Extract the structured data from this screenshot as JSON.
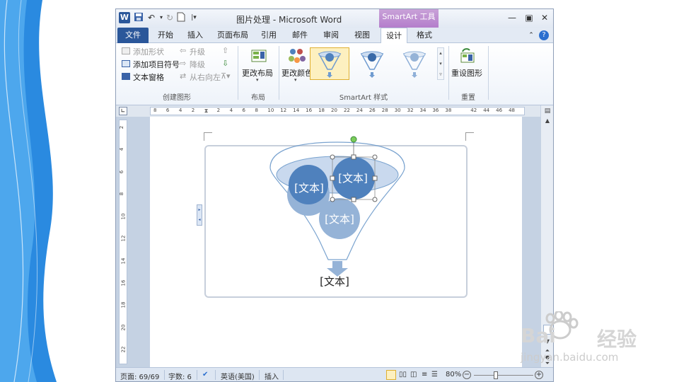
{
  "titlebar": {
    "title": "图片处理 - Microsoft Word",
    "context_group": "SmartArt 工具",
    "app_icon_letter": "W"
  },
  "tabs": [
    "文件",
    "开始",
    "插入",
    "页面布局",
    "引用",
    "邮件",
    "审阅",
    "视图",
    "设计",
    "格式"
  ],
  "ribbon": {
    "create_graphic": {
      "add_shape": "添加形状",
      "add_bullet": "添加项目符号",
      "text_pane": "文本窗格",
      "promote": "升级",
      "demote": "降级",
      "right_to_left": "从右向左",
      "label": "创建图形"
    },
    "layouts": {
      "change_layout": "更改布局",
      "label": "布局"
    },
    "styles": {
      "change_colors": "更改颜色",
      "label": "SmartArt 样式"
    },
    "reset": {
      "reset_graphic": "重设图形",
      "label": "重置"
    }
  },
  "ruler": {
    "ticks": [
      "8",
      "6",
      "4",
      "2",
      "",
      "2",
      "4",
      "6",
      "8",
      "10",
      "12",
      "14",
      "16",
      "18",
      "20",
      "22",
      "24",
      "26",
      "28",
      "30",
      "32",
      "34",
      "36",
      "38",
      "",
      "42",
      "44",
      "46",
      "48"
    ],
    "vticks": [
      "2",
      "",
      "4",
      "",
      "6",
      "",
      "8",
      "",
      "10",
      "",
      "12",
      "",
      "14",
      "",
      "16",
      "",
      "18",
      "",
      "20",
      "",
      "22"
    ]
  },
  "smartart": {
    "circle1": "[文本]",
    "circle2": "[文本]",
    "circle3": "[文本]",
    "bottom": "[文本]"
  },
  "status": {
    "page": "页面: 69/69",
    "words": "字数: 6",
    "language": "英语(美国)",
    "mode": "插入",
    "zoom": "80%"
  },
  "watermark": {
    "brand": "Bai",
    "brand2": "经验",
    "url": "jingyan.baidu.com"
  },
  "colors": {
    "accent_blue": "#2b579a",
    "circle_dark": "#4f81bd",
    "circle_light": "#95b3d7",
    "context_purple": "#b37ccb",
    "funnel_line": "#7aa3cf"
  }
}
